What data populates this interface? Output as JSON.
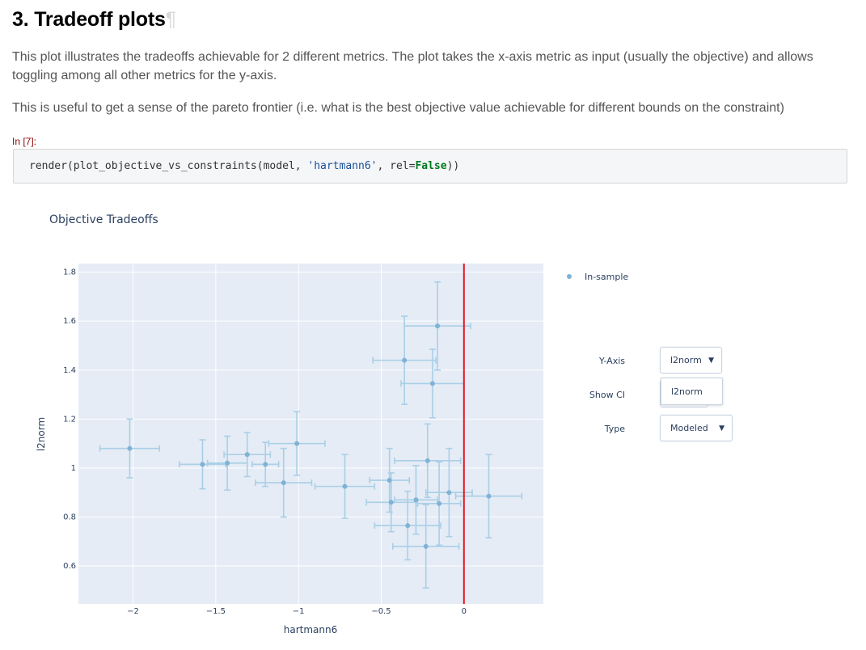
{
  "section": {
    "title": "3. Tradeoff plots",
    "pilcrow": "¶"
  },
  "paragraphs": [
    "This plot illustrates the tradeoffs achievable for 2 different metrics. The plot takes the x-axis metric as input (usually the objective) and allows toggling among all other metrics for the y-axis.",
    "This is useful to get a sense of the pareto frontier (i.e. what is the best objective value achievable for different bounds on the constraint)"
  ],
  "cell": {
    "prompt": "In [7]:",
    "code_pre": "render(plot_objective_vs_constraints(model, ",
    "code_str": "'hartmann6'",
    "code_mid": ", rel=",
    "code_kw": "False",
    "code_post": "))"
  },
  "controls": {
    "y_axis": {
      "label": "Y-Axis",
      "value": "l2norm",
      "open_option": "l2norm"
    },
    "show_ci": {
      "label": "Show CI"
    },
    "type": {
      "label": "Type",
      "value": "Modeled"
    },
    "arrow_icon": "triangle-down-icon"
  },
  "colors": {
    "marker": "#7fb3d5",
    "errorbar": "#a9cfe6",
    "plot_bg": "#e5ecf6",
    "threshold": "#e8141c"
  },
  "chart_data": {
    "type": "scatter",
    "title": "Objective Tradeoffs",
    "xlabel": "hartmann6",
    "ylabel": "l2norm",
    "xlim": [
      -2.33,
      0.48
    ],
    "ylim": [
      0.445,
      1.835
    ],
    "x_ticks": [
      -2,
      -1.5,
      -1,
      -0.5,
      0
    ],
    "x_tick_labels": [
      "−2",
      "−1.5",
      "−1",
      "−0.5",
      "0"
    ],
    "y_ticks": [
      0.6,
      0.8,
      1,
      1.2,
      1.4,
      1.6,
      1.8
    ],
    "y_tick_labels": [
      "0.6",
      "0.8",
      "1",
      "1.2",
      "1.4",
      "1.6",
      "1.8"
    ],
    "grid": true,
    "legend": {
      "position": "top-right",
      "entries": [
        "In-sample"
      ]
    },
    "threshold_x": 0,
    "series": [
      {
        "name": "In-sample",
        "points": [
          {
            "x": -2.02,
            "y": 1.08,
            "xerr": 0.18,
            "yerr": 0.12
          },
          {
            "x": -1.58,
            "y": 1.015,
            "xerr": 0.14,
            "yerr": 0.1
          },
          {
            "x": -1.43,
            "y": 1.02,
            "xerr": 0.12,
            "yerr": 0.11
          },
          {
            "x": -1.31,
            "y": 1.055,
            "xerr": 0.14,
            "yerr": 0.09
          },
          {
            "x": -1.2,
            "y": 1.015,
            "xerr": 0.08,
            "yerr": 0.09
          },
          {
            "x": -1.01,
            "y": 1.1,
            "xerr": 0.17,
            "yerr": 0.13
          },
          {
            "x": -1.09,
            "y": 0.94,
            "xerr": 0.17,
            "yerr": 0.14
          },
          {
            "x": -0.72,
            "y": 0.925,
            "xerr": 0.18,
            "yerr": 0.13
          },
          {
            "x": -0.36,
            "y": 1.44,
            "xerr": 0.19,
            "yerr": 0.18
          },
          {
            "x": -0.16,
            "y": 1.58,
            "xerr": 0.2,
            "yerr": 0.18
          },
          {
            "x": -0.19,
            "y": 1.345,
            "xerr": 0.19,
            "yerr": 0.14
          },
          {
            "x": -0.22,
            "y": 1.03,
            "xerr": 0.2,
            "yerr": 0.15
          },
          {
            "x": -0.45,
            "y": 0.95,
            "xerr": 0.12,
            "yerr": 0.13
          },
          {
            "x": -0.44,
            "y": 0.86,
            "xerr": 0.15,
            "yerr": 0.12
          },
          {
            "x": -0.29,
            "y": 0.87,
            "xerr": 0.13,
            "yerr": 0.14
          },
          {
            "x": -0.09,
            "y": 0.9,
            "xerr": 0.14,
            "yerr": 0.18
          },
          {
            "x": -0.15,
            "y": 0.855,
            "xerr": 0.13,
            "yerr": 0.17
          },
          {
            "x": -0.34,
            "y": 0.765,
            "xerr": 0.2,
            "yerr": 0.14
          },
          {
            "x": -0.23,
            "y": 0.68,
            "xerr": 0.2,
            "yerr": 0.17
          },
          {
            "x": 0.15,
            "y": 0.885,
            "xerr": 0.2,
            "yerr": 0.17
          }
        ]
      }
    ]
  }
}
